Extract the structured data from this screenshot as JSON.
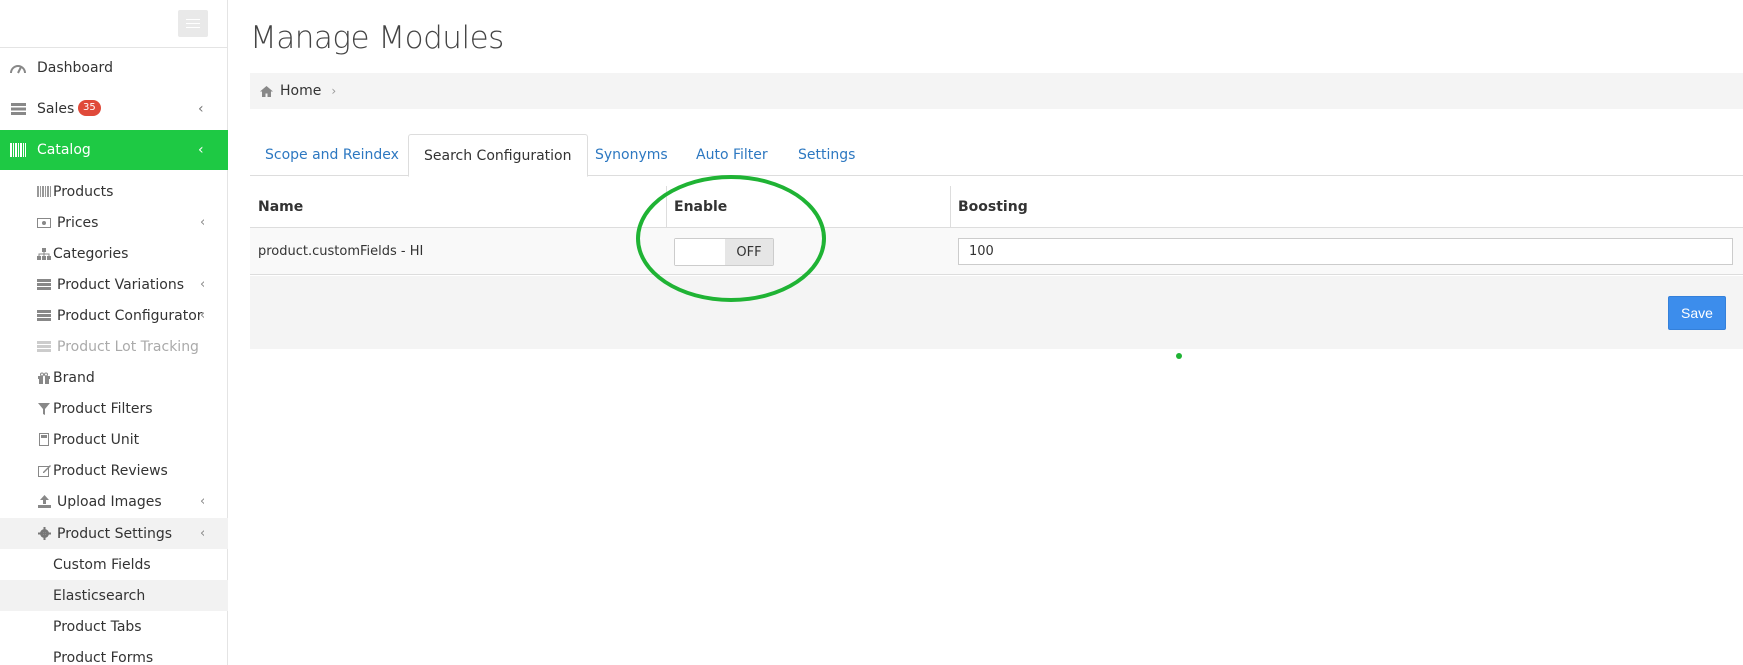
{
  "sidebar": {
    "items": [
      {
        "label": "Dashboard",
        "icon": "dashboard-icon"
      },
      {
        "label": "Sales",
        "badge": "35",
        "icon": "list-icon"
      },
      {
        "label": "Catalog",
        "icon": "barcode-icon",
        "active": true
      }
    ],
    "catalog_sub": [
      {
        "label": "Products",
        "icon": "barcode-icon"
      },
      {
        "label": "Prices",
        "icon": "money-icon"
      },
      {
        "label": "Categories",
        "icon": "sitemap-icon"
      },
      {
        "label": "Product Variations",
        "icon": "list-icon"
      },
      {
        "label": "Product Configurator",
        "icon": "list-icon"
      },
      {
        "label": "Product Lot Tracking",
        "icon": "list-icon",
        "disabled": true
      },
      {
        "label": "Brand",
        "icon": "gift-icon"
      },
      {
        "label": "Product Filters",
        "icon": "filter-icon"
      },
      {
        "label": "Product Unit",
        "icon": "calculator-icon"
      },
      {
        "label": "Product Reviews",
        "icon": "edit-icon"
      },
      {
        "label": "Upload Images",
        "icon": "upload-icon"
      },
      {
        "label": "Product Settings",
        "icon": "gear-icon"
      }
    ],
    "settings_sub": [
      {
        "label": "Custom Fields"
      },
      {
        "label": "Elasticsearch",
        "active": true
      },
      {
        "label": "Product Tabs"
      },
      {
        "label": "Product Forms"
      }
    ]
  },
  "page": {
    "title": "Manage Modules",
    "breadcrumb_home": "Home"
  },
  "tabs": [
    {
      "label": "Scope and Reindex"
    },
    {
      "label": "Search Configuration",
      "active": true
    },
    {
      "label": "Synonyms"
    },
    {
      "label": "Auto Filter"
    },
    {
      "label": "Settings"
    }
  ],
  "table": {
    "headers": {
      "name": "Name",
      "enable": "Enable",
      "boosting": "Boosting"
    },
    "rows": [
      {
        "name": "product.customFields - HI",
        "enable_state": "OFF",
        "boosting": "100"
      }
    ],
    "save_label": "Save"
  },
  "colors": {
    "accent_green": "#1ec944",
    "link_blue": "#2d78c1",
    "save_blue": "#3c8dec",
    "badge_red": "#e04a3a",
    "annotation_green": "#1fb334"
  }
}
